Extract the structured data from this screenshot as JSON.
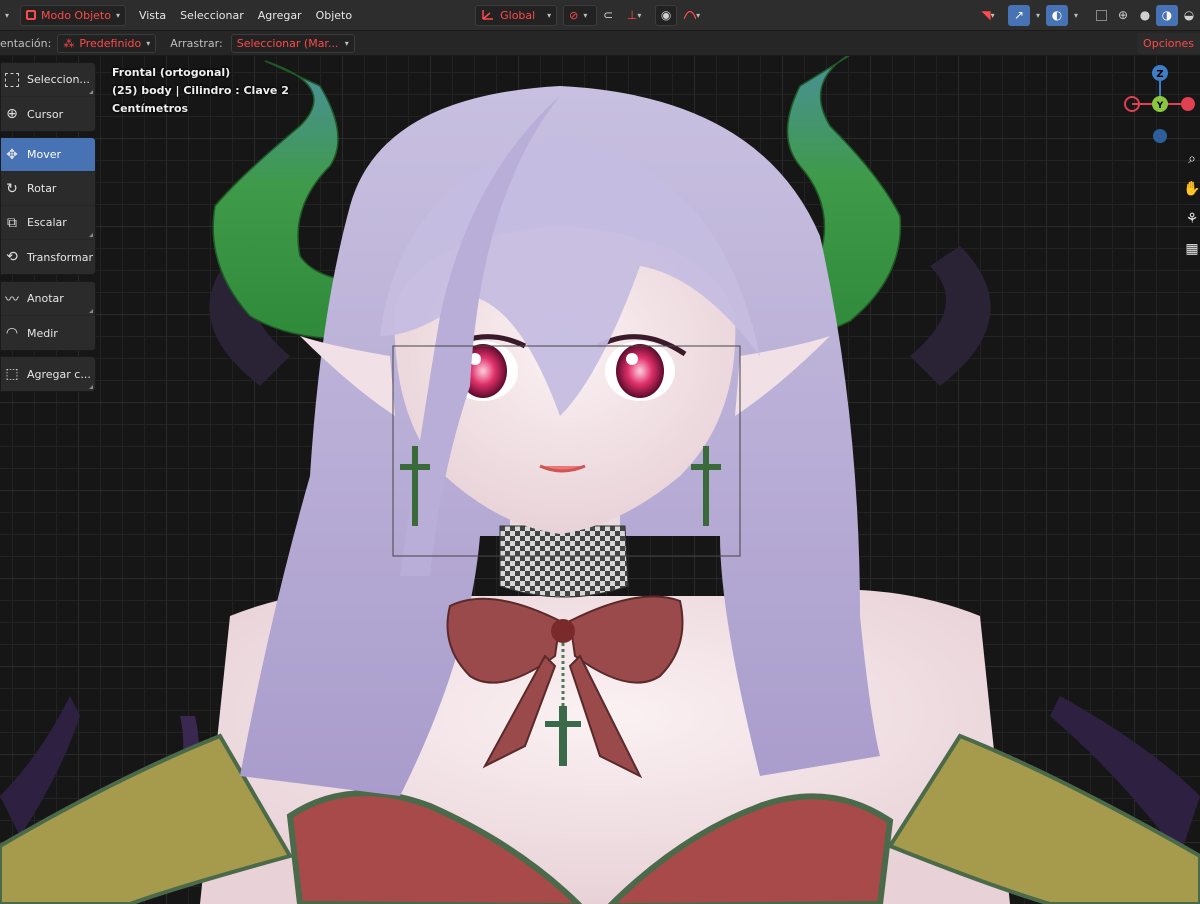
{
  "header": {
    "mode_label": "Modo Objeto",
    "menus": [
      "Vista",
      "Seleccionar",
      "Agregar",
      "Objeto"
    ],
    "transform_orientation": "Global"
  },
  "subheader": {
    "orientation_label": "entación:",
    "orientation_value": "Predefinido",
    "drag_label": "Arrastrar:",
    "drag_value": "Seleccionar (Mar...",
    "options_label": "Opciones"
  },
  "viewport": {
    "view_name": "Frontal (ortogonal)",
    "object_info": "(25) body | Cilindro : Clave 2",
    "units": "Centímetros"
  },
  "toolbar": {
    "tools": [
      {
        "label": "Seleccion...",
        "icon": "select-box-icon",
        "active": false
      },
      {
        "label": "Cursor",
        "icon": "cursor-icon",
        "active": false
      },
      {
        "label": "Mover",
        "icon": "move-icon",
        "active": true
      },
      {
        "label": "Rotar",
        "icon": "rotate-icon",
        "active": false
      },
      {
        "label": "Escalar",
        "icon": "scale-icon",
        "active": false
      },
      {
        "label": "Transformar",
        "icon": "transform-icon",
        "active": false
      },
      {
        "label": "Anotar",
        "icon": "annotate-icon",
        "active": false
      },
      {
        "label": "Medir",
        "icon": "measure-icon",
        "active": false
      },
      {
        "label": "Agregar c...",
        "icon": "add-cube-icon",
        "active": false
      }
    ]
  },
  "gizmo": {
    "axes": [
      "Z",
      "Y"
    ]
  },
  "colors": {
    "accent": "#4772b3",
    "header_red": "#ff4a4a",
    "axis_x": "#e04050",
    "axis_y": "#8cc63f",
    "axis_z": "#3d7ec6"
  }
}
